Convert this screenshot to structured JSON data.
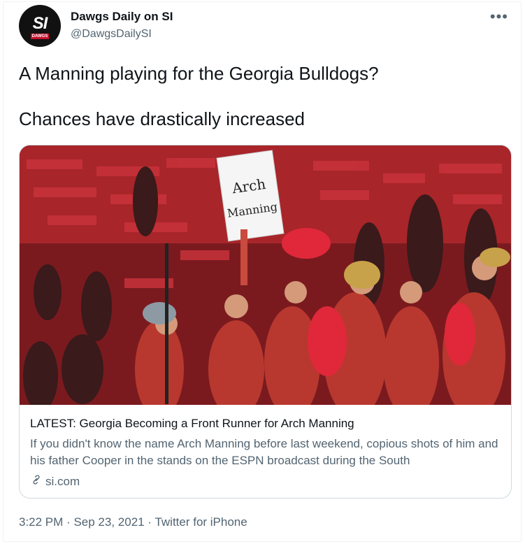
{
  "account": {
    "display_name": "Dawgs Daily on SI",
    "handle": "@DawgsDailySI",
    "avatar_text": "SI",
    "avatar_subtext": "DAWGS"
  },
  "more_label": "•••",
  "tweet": {
    "line1": "A Manning playing for the Georgia Bulldogs?",
    "line2": "Chances have drastically increased"
  },
  "link_card": {
    "sign_text_1": "Arch",
    "sign_text_2": "Manning",
    "title": "LATEST: Georgia Becoming a Front Runner for Arch Manning",
    "description": "If you didn't know the name Arch Manning before last weekend, copious shots of him and his father Cooper in the stands on the ESPN broadcast during the South",
    "domain": "si.com"
  },
  "meta": {
    "time": "3:22 PM",
    "separator": "·",
    "date": "Sep 23, 2021",
    "source": "Twitter for iPhone"
  },
  "colors": {
    "text_primary": "#0f1419",
    "text_secondary": "#536471",
    "border": "#cfd9de",
    "georgia_red": "#c8102e"
  }
}
